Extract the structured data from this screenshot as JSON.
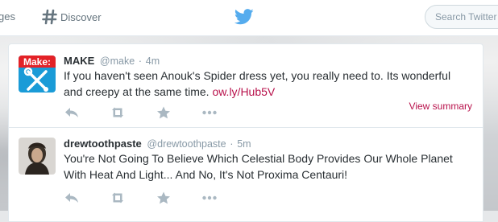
{
  "nav": {
    "partial_label": "ges",
    "discover_label": "Discover",
    "search_placeholder": "Search Twitter"
  },
  "tweets": [
    {
      "name": "MAKE",
      "handle": "@make",
      "sep": "·",
      "time": "4m",
      "text": "If you haven't seen Anouk's Spider dress yet, you really need to. Its wonderful and creepy at the same time. ",
      "link": "ow.ly/Hub5V",
      "view_summary": "View summary",
      "avatar_text": "Make:",
      "avatar_color": "#1a9bd7"
    },
    {
      "name": "drewtoothpaste",
      "handle": "@drewtoothpaste",
      "sep": "·",
      "time": "5m",
      "text": "You're Not Going To Believe Which Celestial Body Provides Our Whole Planet With Heat And Light... And No, It's Not Proxima Centauri!"
    }
  ],
  "colors": {
    "accent": "#b8114b",
    "twitter_blue": "#55acee",
    "icon_gray": "#aab8c2"
  },
  "icons": {
    "reply": "reply-icon",
    "retweet": "retweet-icon",
    "favorite": "star-icon",
    "more": "more-icon"
  }
}
